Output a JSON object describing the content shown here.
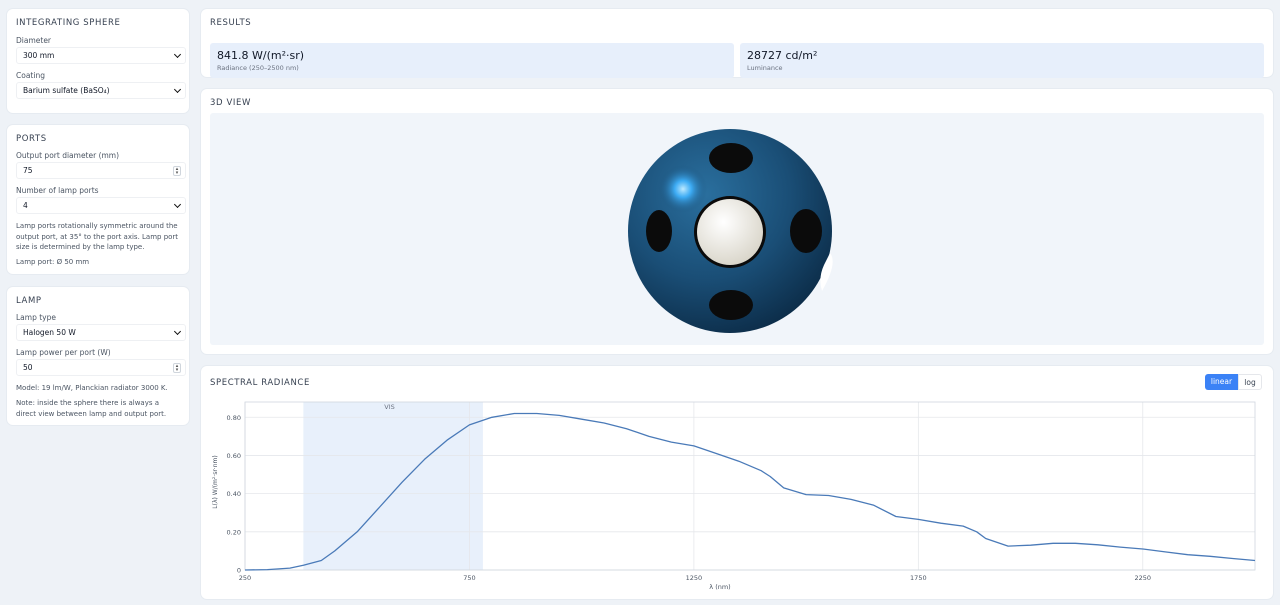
{
  "sphere_panel": {
    "title": "INTEGRATING SPHERE",
    "diameter_label": "Diameter",
    "diameter_value": "300 mm",
    "coating_label": "Coating",
    "coating_value": "Barium sulfate (BaSO₄)"
  },
  "ports_panel": {
    "title": "PORTS",
    "output_label": "Output port diameter (mm)",
    "output_value": "75",
    "lamp_ports_label": "Number of lamp ports",
    "lamp_ports_value": "4",
    "note": "Lamp ports rotationally symmetric around the output port, at 35° to the port axis. Lamp port size is determined by the lamp type.",
    "lamp_port_size": "Lamp port: Ø 50 mm"
  },
  "lamp_panel": {
    "title": "LAMP",
    "type_label": "Lamp type",
    "type_value": "Halogen 50 W",
    "power_label": "Lamp power per port (W)",
    "power_value": "50",
    "model_note": "Model: 19 lm/W, Planckian radiator 3000 K.",
    "direct_note": "Note: inside the sphere there is always a direct view between lamp and output port."
  },
  "results": {
    "title": "RESULTS",
    "radiance_value": "841.8 W/(m²·sr)",
    "radiance_label": "Radiance (250–2500 nm)",
    "luminance_value": "28727 cd/m²",
    "luminance_label": "Luminance"
  },
  "view3d": {
    "title": "3D VIEW"
  },
  "spectral": {
    "title": "SPECTRAL RADIANCE",
    "scale_linear": "linear",
    "scale_log": "log",
    "active_scale": "linear"
  },
  "colors": {
    "accent": "#3b82f6",
    "curve": "#4a7ab8",
    "vis_band": "#e8f0fb",
    "sphere": "#1b4f75"
  },
  "chart_data": {
    "type": "line",
    "xlabel": "λ (nm)",
    "ylabel": "L(λ) W/(m²·sr·nm)",
    "xlim": [
      250,
      2500
    ],
    "ylim": [
      0,
      0.88
    ],
    "x_ticks": [
      "250",
      "750",
      "1250",
      "1750",
      "2250"
    ],
    "y_ticks": [
      "0",
      "0.20",
      "0.40",
      "0.60",
      "0.80"
    ],
    "band": {
      "label": "VIS",
      "from": 380,
      "to": 780
    },
    "grid": true,
    "series": [
      {
        "x": [
          250,
          300,
          350,
          380,
          420,
          450,
          500,
          550,
          600,
          650,
          700,
          750,
          800,
          850,
          900,
          950,
          1000,
          1050,
          1100,
          1150,
          1200,
          1250,
          1300,
          1350,
          1400,
          1420,
          1450,
          1500,
          1550,
          1600,
          1650,
          1700,
          1750,
          1800,
          1850,
          1880,
          1900,
          1950,
          2000,
          2050,
          2100,
          2150,
          2200,
          2250,
          2300,
          2350,
          2400,
          2450,
          2500
        ],
        "y": [
          0.0,
          0.002,
          0.01,
          0.025,
          0.05,
          0.1,
          0.2,
          0.33,
          0.46,
          0.58,
          0.68,
          0.76,
          0.8,
          0.82,
          0.82,
          0.81,
          0.79,
          0.77,
          0.74,
          0.7,
          0.67,
          0.65,
          0.61,
          0.57,
          0.52,
          0.49,
          0.43,
          0.395,
          0.39,
          0.37,
          0.34,
          0.28,
          0.265,
          0.245,
          0.23,
          0.2,
          0.165,
          0.125,
          0.13,
          0.14,
          0.14,
          0.132,
          0.12,
          0.11,
          0.095,
          0.08,
          0.072,
          0.06,
          0.05
        ]
      }
    ]
  }
}
